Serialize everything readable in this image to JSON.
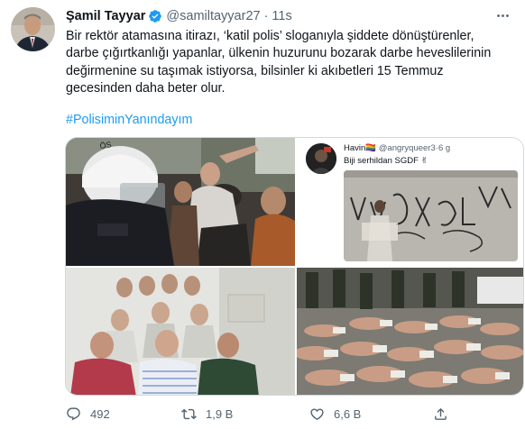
{
  "tweet": {
    "display_name": "Şamil Tayyar",
    "handle": "@samiltayyar27",
    "separator": "·",
    "time": "11s",
    "avatar_icon": "profile-photo",
    "verified_icon": "verified-badge-icon",
    "body_lines": [
      "Bir rektör atamasına itirazı, ‘katil polis’ sloganıyla şiddete dönüştürenler,",
      "darbe çığırtkanlığı yapanlar, ülkenin huzurunu bozarak darbe heveslilerinin",
      "değirmenine su taşımak istiyorsa, bilsinler ki akıbetleri 15 Temmuz",
      "gecesinden daha beter olur."
    ],
    "hashtag": "#PolisiminYanındayım"
  },
  "media": {
    "quoted_tweet": {
      "name": "Havin🏳️‍🌈",
      "handle": "@angryqueer3",
      "time": "6 g",
      "text": "Biji serhildan SGDF ✌"
    }
  },
  "actions": {
    "reply_count": "492",
    "retweet_count": "1,9 B",
    "like_count": "6,6 B",
    "share_label": ""
  },
  "colors": {
    "accent": "#1d9bf0",
    "secondary_text": "#536471",
    "primary_text": "#0f1419",
    "border": "#cfd9de"
  }
}
